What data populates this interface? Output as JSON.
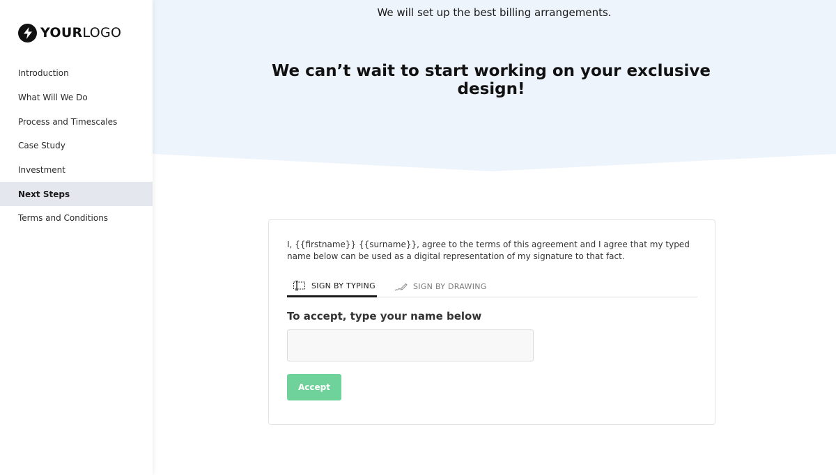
{
  "brand": {
    "logo_strong": "YOUR",
    "logo_light": "LOGO"
  },
  "sidebar": {
    "items": [
      {
        "label": "Introduction",
        "active": false
      },
      {
        "label": "What Will We Do",
        "active": false
      },
      {
        "label": "Process and Timescales",
        "active": false
      },
      {
        "label": "Case Study",
        "active": false
      },
      {
        "label": "Investment",
        "active": false
      },
      {
        "label": "Next Steps",
        "active": true
      },
      {
        "label": "Terms and Conditions",
        "active": false
      }
    ]
  },
  "hero": {
    "subtitle": "We will set up the best billing arrangements.",
    "title": "We can’t wait to start working on your exclusive design!"
  },
  "signature": {
    "agreement": "I, {{firstname}} {{surname}}, agree to the terms of this agreement and I agree that my typed name below can be used as a digital representation of my signature to that fact.",
    "tabs": [
      {
        "label": "SIGN BY TYPING",
        "icon": "type-sign-icon",
        "active": true
      },
      {
        "label": "SIGN BY DRAWING",
        "icon": "pen-icon",
        "active": false
      }
    ],
    "label": "To accept, type your name below",
    "input_value": "",
    "accept_label": "Accept"
  },
  "colors": {
    "hero_bg": "#eef4fc",
    "active_nav_bg": "#e4e7ee",
    "accept_button": "#6fd29a",
    "text_dark": "#111111"
  }
}
